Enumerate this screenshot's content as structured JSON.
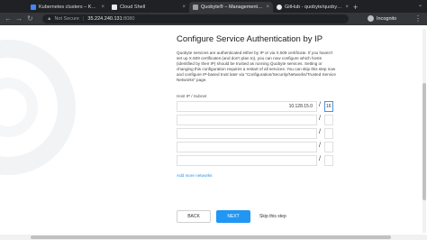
{
  "browser": {
    "tabs": [
      {
        "label": "Kubernetes clusters – Kubern…",
        "favicon_color": "#4285f4",
        "active": false
      },
      {
        "label": "Cloud Shell",
        "favicon_color": "#e8eaed",
        "active": false
      },
      {
        "label": "Quobyte® – Management Cons…",
        "favicon_color": "#9aa0a6",
        "active": true
      },
      {
        "label": "GitHub - quobyte/quobyte-k8s-…",
        "favicon_color": "#e8eaed",
        "active": false
      }
    ],
    "new_tab": "+",
    "address": {
      "security": "Not Secure",
      "host": "35.224.240.131",
      "port": ":8080"
    },
    "profile": "Incognito"
  },
  "page": {
    "title": "Configure Service Authentication by IP",
    "description": "Quobyte services are authenticated either by IP or via X.509 certificate. If you haven't set up X.509 certificates (and don't plan to), you can now configure which hosts (identified by their IP) should be trusted as running Quobyte services. Setting or changing this configuration requires a restart of all services. You can skip this step now and configure IP-based trust later via \"Configuration/Security/Networks/Trusted Service Networks\" page.",
    "host_label": "Host IP / Subnet",
    "rows": [
      {
        "ip": "10.128.15.0",
        "mask": "16"
      },
      {
        "ip": "",
        "mask": ""
      },
      {
        "ip": "",
        "mask": ""
      },
      {
        "ip": "",
        "mask": ""
      },
      {
        "ip": "",
        "mask": ""
      }
    ],
    "slash": "/",
    "add_more": "Add more networks",
    "back": "BACK",
    "next": "NEXT",
    "skip": "Skip this step"
  }
}
